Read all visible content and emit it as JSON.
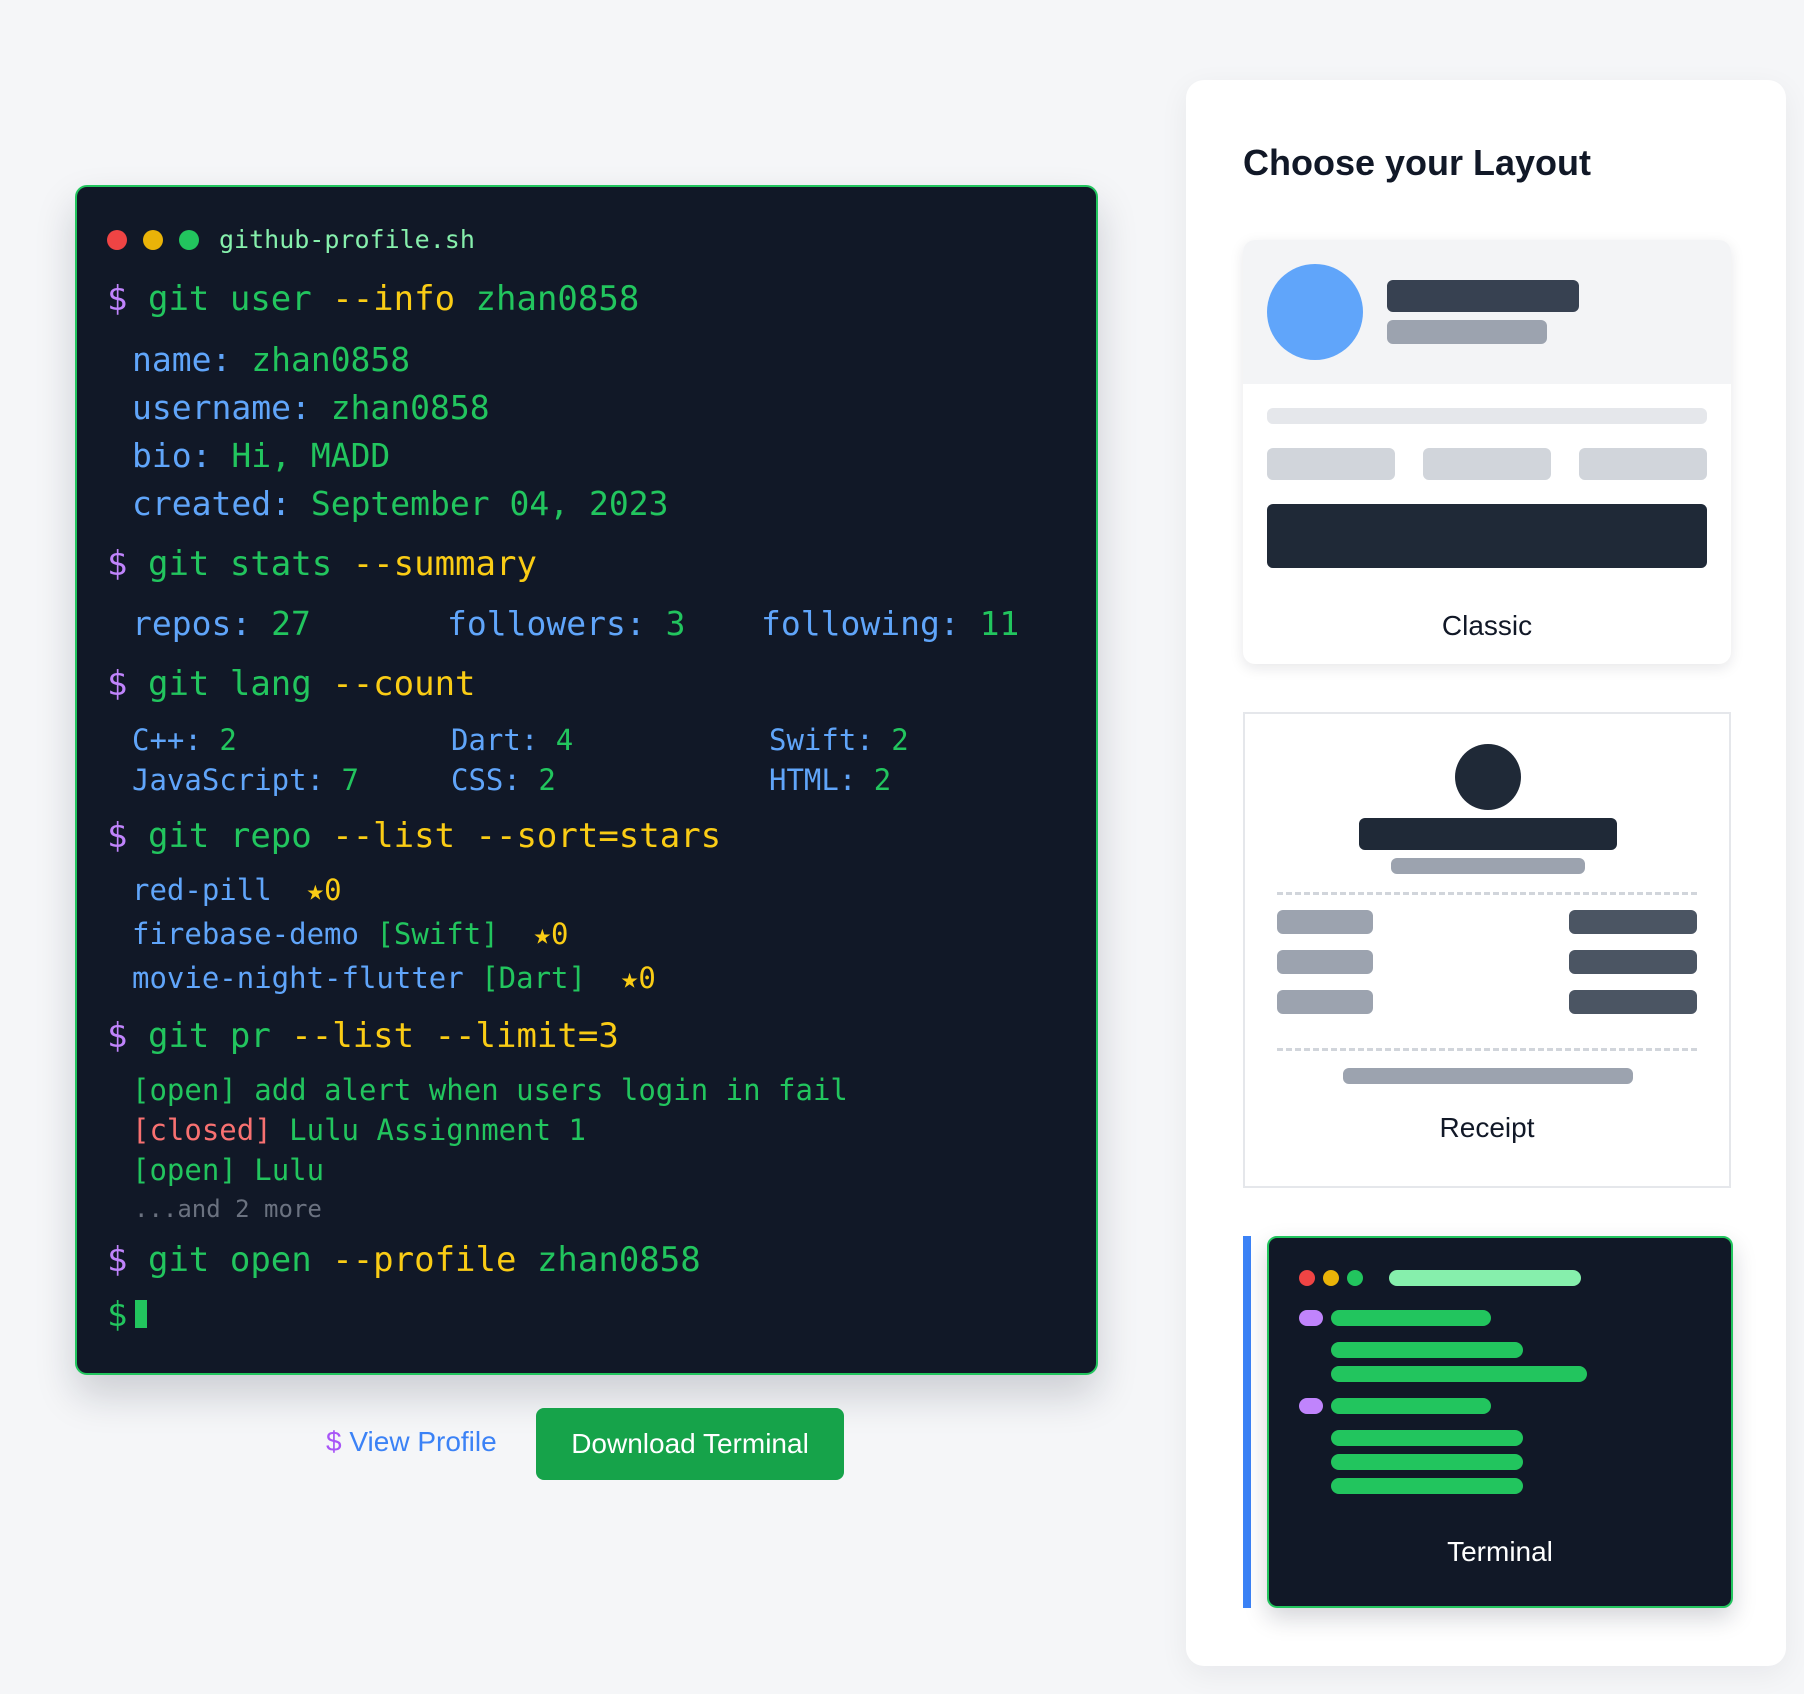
{
  "terminal": {
    "filename": "github-profile.sh",
    "prompt": "$",
    "commands": {
      "user": {
        "base": "git user",
        "flag": "--info",
        "arg": "zhan0858"
      },
      "stats": {
        "base": "git stats",
        "flag": "--summary"
      },
      "lang": {
        "base": "git lang",
        "flag": "--count"
      },
      "repo": {
        "base": "git repo",
        "flag": "--list --sort=stars"
      },
      "pr": {
        "base": "git pr",
        "flag": "--list --limit=3"
      },
      "open": {
        "base": "git open",
        "flag": "--profile",
        "arg": "zhan0858"
      }
    },
    "info": {
      "name_key": "name:",
      "name_val": "zhan0858",
      "username_key": "username:",
      "username_val": "zhan0858",
      "bio_key": "bio:",
      "bio_val": "Hi, MADD",
      "created_key": "created:",
      "created_val": "September 04, 2023"
    },
    "stats": {
      "repos_key": "repos:",
      "repos_val": "27",
      "followers_key": "followers:",
      "followers_val": "3",
      "following_key": "following:",
      "following_val": "11"
    },
    "languages": [
      {
        "name": "C++:",
        "count": "2"
      },
      {
        "name": "Dart:",
        "count": "4"
      },
      {
        "name": "Swift:",
        "count": "2"
      },
      {
        "name": "JavaScript:",
        "count": "7"
      },
      {
        "name": "CSS:",
        "count": "2"
      },
      {
        "name": "HTML:",
        "count": "2"
      }
    ],
    "repos": [
      {
        "name": "red-pill",
        "lang": "",
        "stars": "★0"
      },
      {
        "name": "firebase-demo",
        "lang": "[Swift]",
        "stars": "★0"
      },
      {
        "name": "movie-night-flutter",
        "lang": "[Dart]",
        "stars": "★0"
      }
    ],
    "prs": [
      {
        "status": "[open]",
        "title": "add alert when users login in fail"
      },
      {
        "status": "[closed]",
        "title": "Lulu Assignment 1"
      },
      {
        "status": "[open]",
        "title": "Lulu"
      }
    ],
    "pr_more": "...and 2 more"
  },
  "actions": {
    "view_profile_prefix": "$",
    "view_profile_label": "View Profile",
    "download_label": "Download Terminal"
  },
  "layout_panel": {
    "title": "Choose your Layout",
    "options": [
      {
        "label": "Classic",
        "selected": false
      },
      {
        "label": "Receipt",
        "selected": false
      },
      {
        "label": "Terminal",
        "selected": true
      }
    ]
  },
  "colors": {
    "accent_green": "#22c55e",
    "selection_blue": "#3b82f6",
    "terminal_bg": "#111827"
  }
}
